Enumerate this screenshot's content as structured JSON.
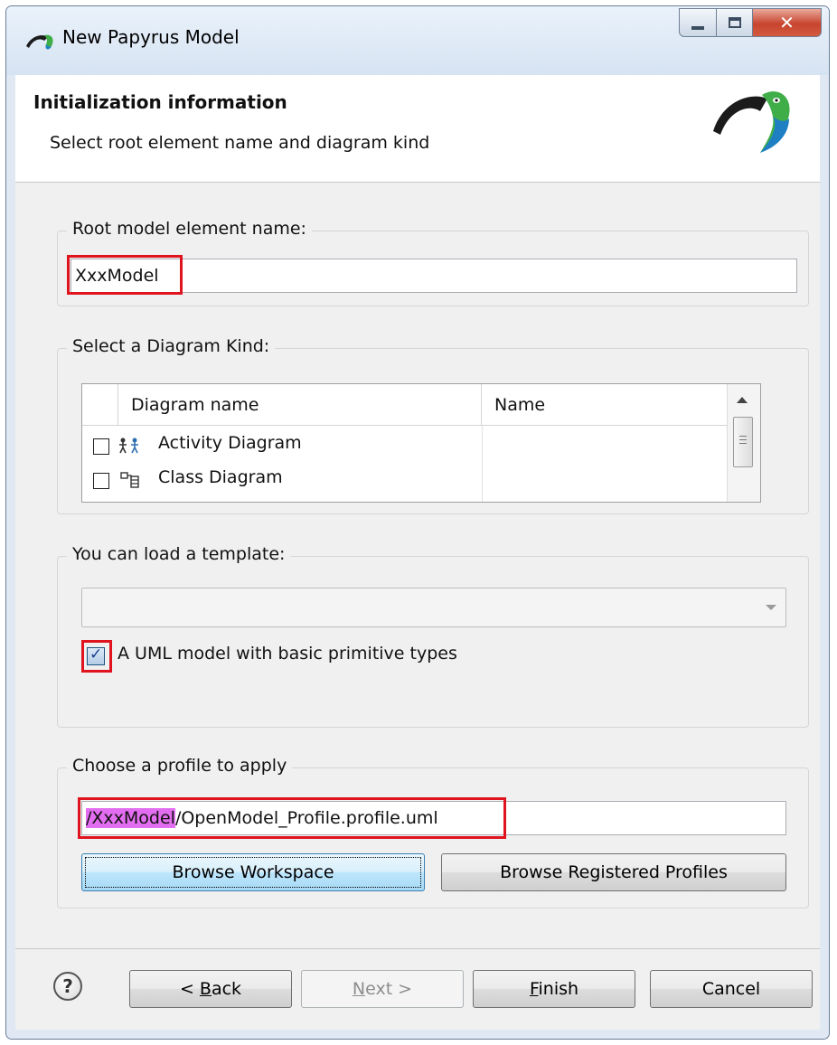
{
  "window": {
    "title": "New Papyrus Model"
  },
  "banner": {
    "title": "Initialization information",
    "description": "Select root element name and diagram kind"
  },
  "root_name": {
    "legend": "Root model element name:",
    "value": "XxxModel"
  },
  "diagram_kind": {
    "legend": "Select a Diagram Kind:",
    "columns": [
      "Diagram name",
      "Name"
    ],
    "rows": [
      {
        "label": "Activity Diagram",
        "checked": false,
        "icon": "activity-diagram-icon"
      },
      {
        "label": "Class Diagram",
        "checked": false,
        "icon": "class-diagram-icon"
      }
    ]
  },
  "template": {
    "legend": "You can load a template:",
    "selected": "",
    "checkbox_label": "A UML model with basic primitive types",
    "checked": true
  },
  "profile": {
    "legend": "Choose a profile to apply",
    "path_highlight": "/XxxModel",
    "path_rest": "/OpenModel_Profile.profile.uml",
    "browse_workspace": "Browse Workspace",
    "browse_registered": "Browse Registered Profiles"
  },
  "footer": {
    "help_label": "?",
    "back_prefix": "< ",
    "back_key": "B",
    "back_rest": "ack",
    "next_key": "N",
    "next_rest": "ext >",
    "finish_key": "F",
    "finish_rest": "inish",
    "cancel": "Cancel"
  },
  "colors": {
    "highlight": "#e0141e",
    "selection": "#e36df0"
  }
}
